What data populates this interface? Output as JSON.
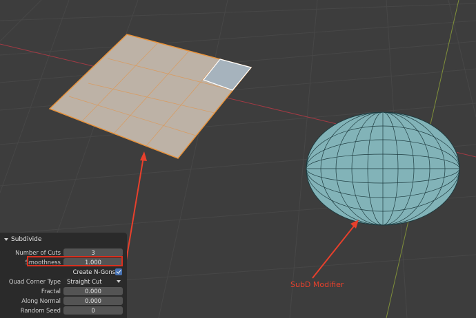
{
  "annotation": {
    "label": "SubD Modifier",
    "color": "#e8402c"
  },
  "operator_panel": {
    "title": "Subdivide",
    "rows": [
      {
        "label": "Number of Cuts",
        "value": "3"
      },
      {
        "label": "Smoothness",
        "value": "1.000"
      }
    ],
    "create_ngons": {
      "label": "Create N-Gons",
      "checked": true
    },
    "quad_corner": {
      "label": "Quad Corner Type",
      "value": "Straight Cut"
    },
    "rows2": [
      {
        "label": "Fractal",
        "value": "0.000"
      },
      {
        "label": "Along Normal",
        "value": "0.000"
      },
      {
        "label": "Random Seed",
        "value": "0"
      }
    ]
  },
  "colors": {
    "background": "#3d3d3d",
    "grid": "#464646",
    "x_axis": "#a33a44",
    "y_axis": "#8a9a3a",
    "plane_face": "#bdb2a6",
    "plane_edge": "#e8923a",
    "selected_face": "#a6b3bd",
    "sphere_face": "#82b3b8",
    "sphere_edge": "#1e3c40",
    "annotation": "#e8402c"
  }
}
